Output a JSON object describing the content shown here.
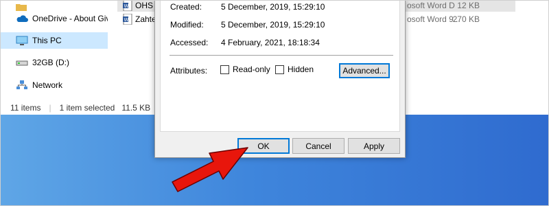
{
  "explorer": {
    "nav_items": [
      {
        "label": "OneDrive - About Giv",
        "icon": "onedrive-cloud-icon"
      },
      {
        "label": "This PC",
        "icon": "this-pc-icon"
      },
      {
        "label": "32GB (D:)",
        "icon": "drive-icon"
      },
      {
        "label": "Network",
        "icon": "network-icon"
      }
    ],
    "files": [
      {
        "name": "OHS",
        "type": "osoft Word D",
        "size": "12 KB",
        "icon": "word-document-icon"
      },
      {
        "name": "Zahte",
        "type": "osoft Word 9...",
        "size": "270 KB",
        "icon": "word-document-icon"
      }
    ],
    "status": {
      "count": "11 items",
      "selection": "1 item selected",
      "size": "11.5 KB"
    }
  },
  "dialog": {
    "created_label": "Created:",
    "created_value": "5 December, 2019, 15:29:10",
    "modified_label": "Modified:",
    "modified_value": "5 December, 2019, 15:29:10",
    "accessed_label": "Accessed:",
    "accessed_value": "4 February, 2021, 18:18:34",
    "attributes_label": "Attributes:",
    "readonly_label": "Read-only",
    "readonly_checked": false,
    "hidden_label": "Hidden",
    "hidden_checked": false,
    "advanced_label": "Advanced...",
    "ok_label": "OK",
    "cancel_label": "Cancel",
    "apply_label": "Apply"
  },
  "colors": {
    "desktop_left": "#5fa6e6",
    "desktop_right": "#2f6bcf",
    "selection": "#cce8ff",
    "focus_border": "#0078d7",
    "arrow": "#e8160c"
  }
}
